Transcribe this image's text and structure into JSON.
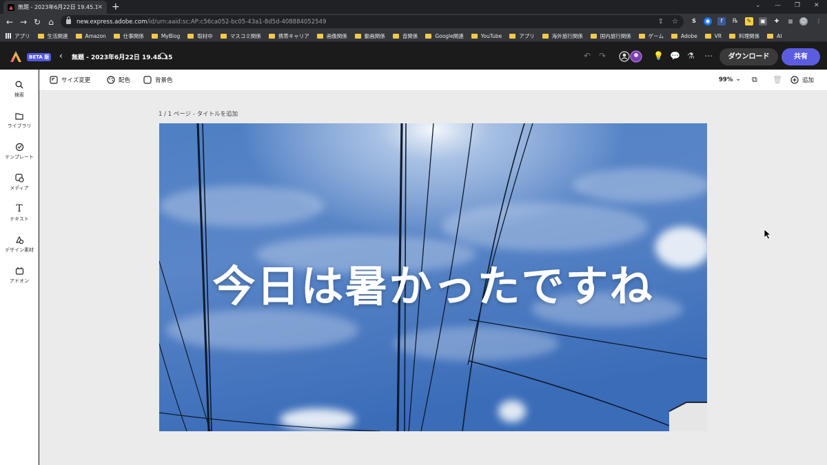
{
  "browser": {
    "tab_title": "無題 - 2023年6月22日 19.45.15",
    "url_host": "new.express.adobe.com",
    "url_path": "/id/urn:aaid:sc:AP:c56ca052-bc05-43a1-8d5d-408884052549",
    "bookmarks": [
      {
        "label": "アプリ",
        "type": "apps"
      },
      {
        "label": "生活関連",
        "type": "folder"
      },
      {
        "label": "Amazon",
        "type": "folder"
      },
      {
        "label": "仕事関係",
        "type": "folder"
      },
      {
        "label": "MyBlog",
        "type": "folder"
      },
      {
        "label": "取材中",
        "type": "folder"
      },
      {
        "label": "マスコミ関係",
        "type": "folder"
      },
      {
        "label": "携帯キャリア",
        "type": "folder"
      },
      {
        "label": "画像関係",
        "type": "folder"
      },
      {
        "label": "動画関係",
        "type": "folder"
      },
      {
        "label": "音関係",
        "type": "folder"
      },
      {
        "label": "Google関連",
        "type": "folder"
      },
      {
        "label": "YouTube",
        "type": "folder"
      },
      {
        "label": "アプリ",
        "type": "folder"
      },
      {
        "label": "海外旅行関係",
        "type": "folder"
      },
      {
        "label": "国内旅行関係",
        "type": "folder"
      },
      {
        "label": "ゲーム",
        "type": "folder"
      },
      {
        "label": "Adobe",
        "type": "folder"
      },
      {
        "label": "VR",
        "type": "folder"
      },
      {
        "label": "料理関係",
        "type": "folder"
      },
      {
        "label": "AI",
        "type": "folder"
      }
    ]
  },
  "app": {
    "beta_label": "BETA 版",
    "doc_title": "無題 - 2023年6月22日 19.45.15",
    "download_label": "ダウンロード",
    "share_label": "共有",
    "brand_color": "#5c5ce0"
  },
  "rail": [
    {
      "label": "検索",
      "icon": "search-icon"
    },
    {
      "label": "ライブラリ",
      "icon": "folder-icon"
    },
    {
      "label": "テンプレート",
      "icon": "template-icon"
    },
    {
      "label": "メディア",
      "icon": "media-icon"
    },
    {
      "label": "テキスト",
      "icon": "text-icon"
    },
    {
      "label": "デザイン素材",
      "icon": "shapes-icon"
    },
    {
      "label": "アドオン",
      "icon": "addon-icon"
    }
  ],
  "toolbar": {
    "resize_label": "サイズ変更",
    "color_label": "配色",
    "background_label": "背景色",
    "zoom": "99%",
    "add_label": "追加"
  },
  "canvas": {
    "page_label": "1 / 1 ページ - タイトルを追加",
    "headline": "今日は暑かったですね"
  }
}
